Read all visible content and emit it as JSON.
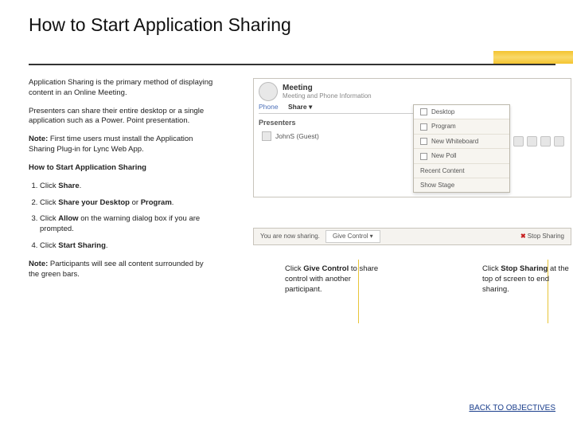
{
  "header": {
    "title": "How to Start Application Sharing"
  },
  "intro": {
    "p1": "Application Sharing is the primary method of displaying content in an Online Meeting.",
    "p2": "Presenters can share their entire desktop or a single application such as a Power. Point presentation.",
    "note_lead": "Note:",
    "note": " First time users must install the Application Sharing Plug-in for Lync Web App.",
    "how": "How to Start Application Sharing"
  },
  "steps": {
    "s1_a": "Click ",
    "s1_b": "Share",
    "s1_c": ".",
    "s2_a": "Click ",
    "s2_b": "Share your Desktop",
    "s2_c": " or ",
    "s2_d": "Program",
    "s2_e": ".",
    "s3_a": "Click ",
    "s3_b": "Allow",
    "s3_c": " on the warning dialog box if you are prompted.",
    "s4_a": "Click ",
    "s4_b": "Start Sharing",
    "s4_c": "."
  },
  "note2": {
    "lead": "Note:",
    "body": " Participants will see all content surrounded by the green bars."
  },
  "illus": {
    "meet_title": "Meeting",
    "meet_sub": "Meeting and Phone Information",
    "tab_phone": "Phone",
    "tab_share": "Share ▾",
    "presenters_label": "Presenters",
    "presenter": "JohnS  (Guest)",
    "menu": {
      "desktop": "Desktop",
      "program": "Program",
      "whiteboard": "New Whiteboard",
      "poll": "New Poll",
      "recent": "Recent Content",
      "stage": "Show Stage"
    }
  },
  "bar": {
    "you": "You are now sharing.",
    "give": "Give Control ▾",
    "stop": "Stop Sharing",
    "x": "✖"
  },
  "callouts": {
    "c1_a": "Click ",
    "c1_b": "Give Control",
    "c1_c": " to share control with another participant.",
    "c2_a": "Click ",
    "c2_b": "Stop Sharing",
    "c2_c": " at the top of screen to end sharing."
  },
  "footer": {
    "link": "BACK TO OBJECTIVES"
  }
}
